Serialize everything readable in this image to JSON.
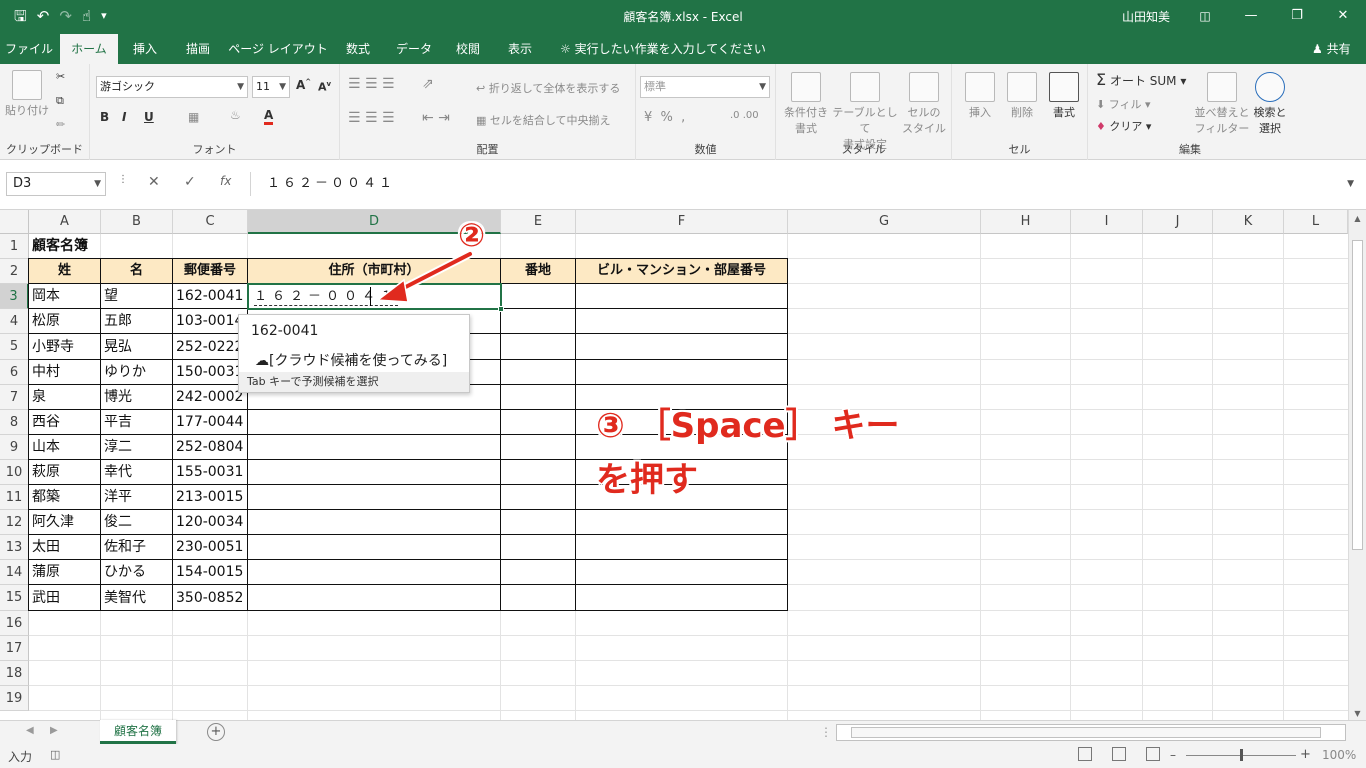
{
  "window": {
    "title": "顧客名簿.xlsx  -  Excel",
    "user": "山田知美"
  },
  "tabs": [
    {
      "label": "ファイル"
    },
    {
      "label": "ホーム"
    },
    {
      "label": "挿入"
    },
    {
      "label": "描画"
    },
    {
      "label": "ページ レイアウト"
    },
    {
      "label": "数式"
    },
    {
      "label": "データ"
    },
    {
      "label": "校閲"
    },
    {
      "label": "表示"
    }
  ],
  "tell_me": "実行したい作業を入力してください",
  "share": "共有",
  "ribbon": {
    "clipboard": {
      "label": "クリップボード",
      "paste": "貼り付け"
    },
    "font": {
      "label": "フォント",
      "name": "游ゴシック",
      "size": "11"
    },
    "alignment": {
      "label": "配置",
      "wrap": "折り返して全体を表示する",
      "merge": "セルを結合して中央揃え"
    },
    "number": {
      "label": "数値",
      "format": "標準"
    },
    "styles": {
      "label": "スタイル",
      "conditional": "条件付き\n書式",
      "table": "テーブルとして\n書式設定",
      "cell": "セルの\nスタイル"
    },
    "cells": {
      "label": "セル",
      "insert": "挿入",
      "delete": "削除",
      "format": "書式"
    },
    "editing": {
      "label": "編集",
      "autosum": "オート SUM",
      "fill": "フィル",
      "clear": "クリア",
      "sort": "並べ替えと\nフィルター",
      "find": "検索と\n選択"
    }
  },
  "formula_bar": {
    "name_box": "D3",
    "content": "１６２－００４１"
  },
  "columns": [
    "A",
    "B",
    "C",
    "D",
    "E",
    "F",
    "G",
    "H",
    "I",
    "J",
    "K",
    "L"
  ],
  "rows": [
    "1",
    "2",
    "3",
    "4",
    "5",
    "6",
    "7",
    "8",
    "9",
    "10",
    "11",
    "12",
    "13",
    "14",
    "15",
    "16",
    "17",
    "18",
    "19"
  ],
  "sheet": {
    "title": "顧客名簿",
    "headers": [
      "姓",
      "名",
      "郵便番号",
      "住所（市町村）",
      "番地",
      "ビル・マンション・部屋番号"
    ],
    "records": [
      [
        "岡本",
        "望",
        "162-0041"
      ],
      [
        "松原",
        "五郎",
        "103-0014"
      ],
      [
        "小野寺",
        "晃弘",
        "252-0222"
      ],
      [
        "中村",
        "ゆりか",
        "150-0031"
      ],
      [
        "泉",
        "博光",
        "242-0002"
      ],
      [
        "西谷",
        "平吉",
        "177-0044"
      ],
      [
        "山本",
        "淳二",
        "252-0804"
      ],
      [
        "萩原",
        "幸代",
        "155-0031"
      ],
      [
        "都築",
        "洋平",
        "213-0015"
      ],
      [
        "阿久津",
        "俊二",
        "120-0034"
      ],
      [
        "太田",
        "佐和子",
        "230-0051"
      ],
      [
        "蒲原",
        "ひかる",
        "154-0015"
      ],
      [
        "武田",
        "美智代",
        "350-0852"
      ]
    ],
    "editing_value": "１６２－００４１"
  },
  "ime": {
    "candidate": "162-0041",
    "cloud": "[クラウド候補を使ってみる]",
    "hint": "Tab キーで予測候補を選択"
  },
  "annotations": {
    "step2": "②",
    "step3_line1": "③ ［Space］ キー",
    "step3_line2": "を押す",
    "accent": "#e02a1e"
  },
  "sheet_tab": "顧客名簿",
  "status": {
    "mode": "入力",
    "zoom": "100%"
  },
  "colors": {
    "excel_green": "#217346",
    "header_fill": "#fde9c4"
  }
}
